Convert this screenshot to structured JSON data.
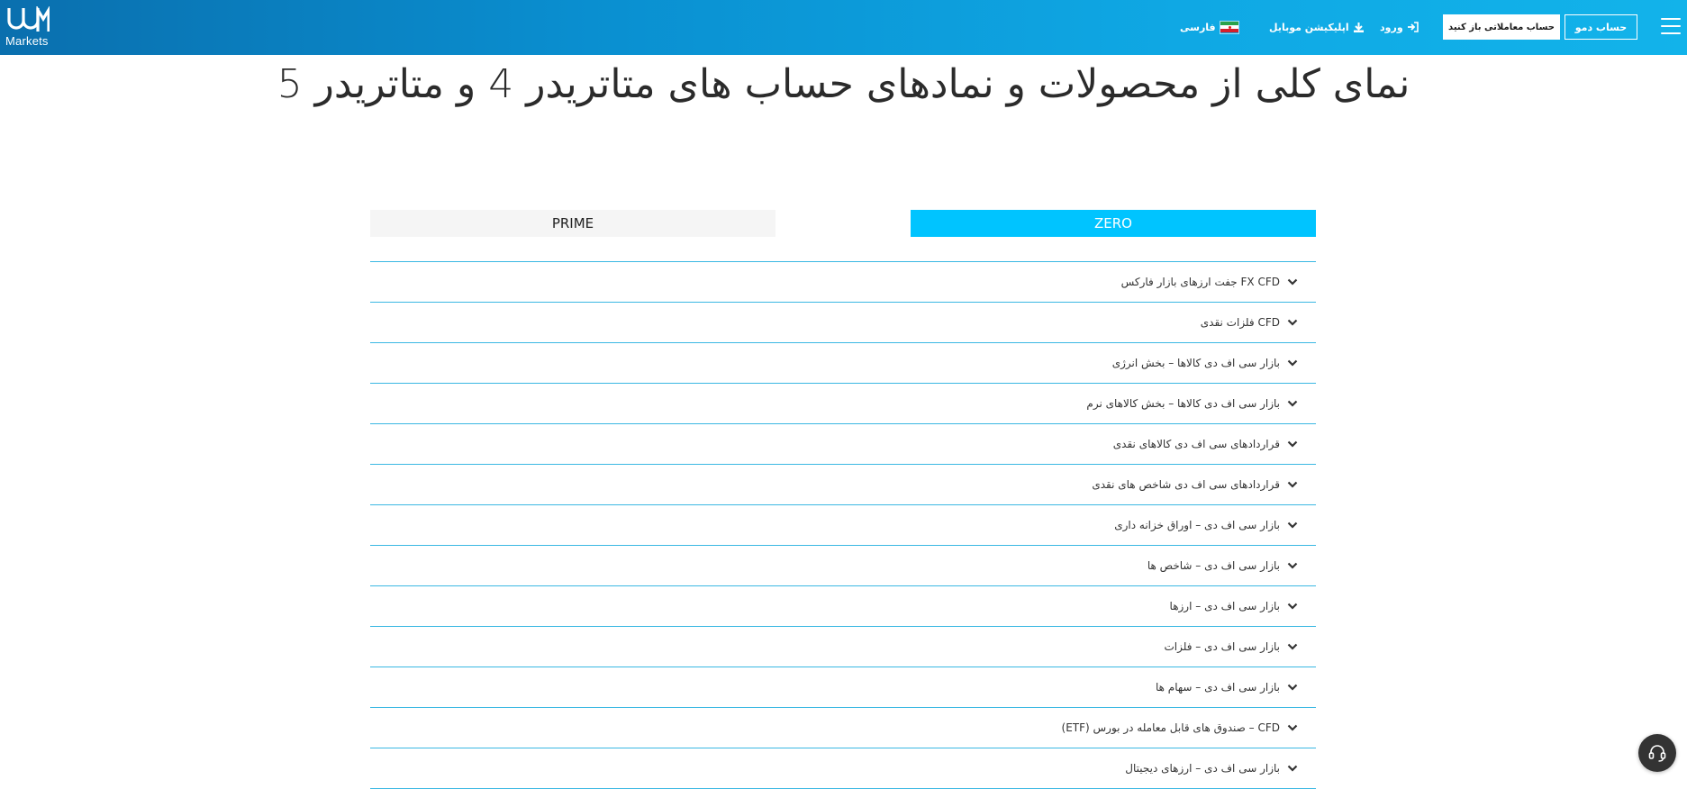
{
  "header": {
    "logo_text": "Markets",
    "demo_button": "حساب دمو",
    "open_account_button": "حساب معاملاتی باز کنید",
    "login_label": "ورود",
    "mobile_app_label": "اپلیکیشن موبایل",
    "language_label": "فارسی",
    "colors": {
      "bar_start": "#0a6fae",
      "bar_end": "#12b3ea"
    }
  },
  "page": {
    "title": "نمای کلی از محصولات و نمادهای حساب های متاتریدر 4 و متاتریدر 5"
  },
  "tabs": [
    {
      "label": "ZERO",
      "active": true
    },
    {
      "label": "PRIME",
      "active": false
    }
  ],
  "accordion": {
    "items": [
      "FX CFD جفت ارزهای بازار فارکس",
      "CFD فلزات نقدی",
      "بازار سی اف دی کالاها – بخش انرژی",
      "بازار سی اف دی کالاها – بخش کالاهای نرم",
      "قراردادهای سی اف دی کالاهای نقدی",
      "قراردادهای سی اف دی شاخص های نقدی",
      "بازار سی اف دی – اوراق خزانه داری",
      "بازار سی اف دی – شاخص ها",
      "بازار سی اف دی – ارزها",
      "بازار سی اف دی – فلزات",
      "بازار سی اف دی – سهام ها",
      "CFD – صندوق های قابل معامله در بورس (ETF)",
      "بازار سی اف دی – ارزهای دیجیتال"
    ],
    "accent_color": "#3bb8e3",
    "chevron_icon": "chevron-down-icon"
  },
  "support": {
    "icon": "headset-icon"
  }
}
